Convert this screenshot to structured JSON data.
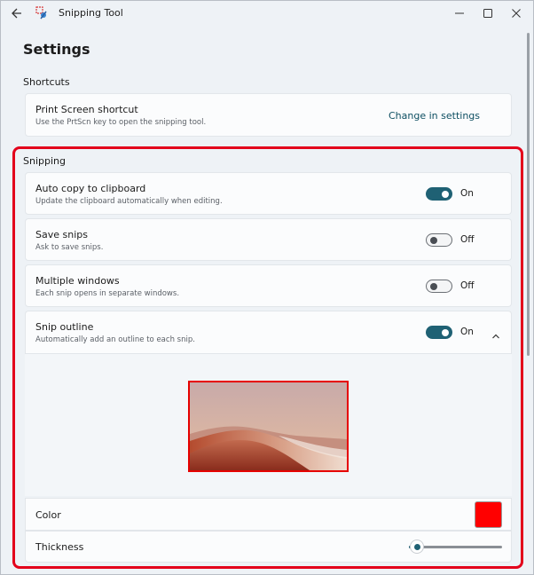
{
  "window": {
    "title": "Snipping Tool"
  },
  "page": {
    "title": "Settings"
  },
  "shortcuts": {
    "section_label": "Shortcuts",
    "print_screen": {
      "title": "Print Screen shortcut",
      "subtitle": "Use the PrtScn key to open the snipping tool.",
      "link_label": "Change in settings"
    }
  },
  "snipping": {
    "section_label": "Snipping",
    "items": [
      {
        "title": "Auto copy to clipboard",
        "subtitle": "Update the clipboard automatically when editing.",
        "state": "On"
      },
      {
        "title": "Save snips",
        "subtitle": "Ask to save snips.",
        "state": "Off"
      },
      {
        "title": "Multiple windows",
        "subtitle": "Each snip opens in separate windows.",
        "state": "Off"
      },
      {
        "title": "Snip outline",
        "subtitle": "Automatically add an outline to each snip.",
        "state": "On"
      }
    ],
    "outline": {
      "color_label": "Color",
      "color_value": "#ff0000",
      "thickness_label": "Thickness",
      "thickness_value": 0.08
    }
  },
  "colors": {
    "accent": "#1f6174",
    "highlight": "#e3001b"
  }
}
